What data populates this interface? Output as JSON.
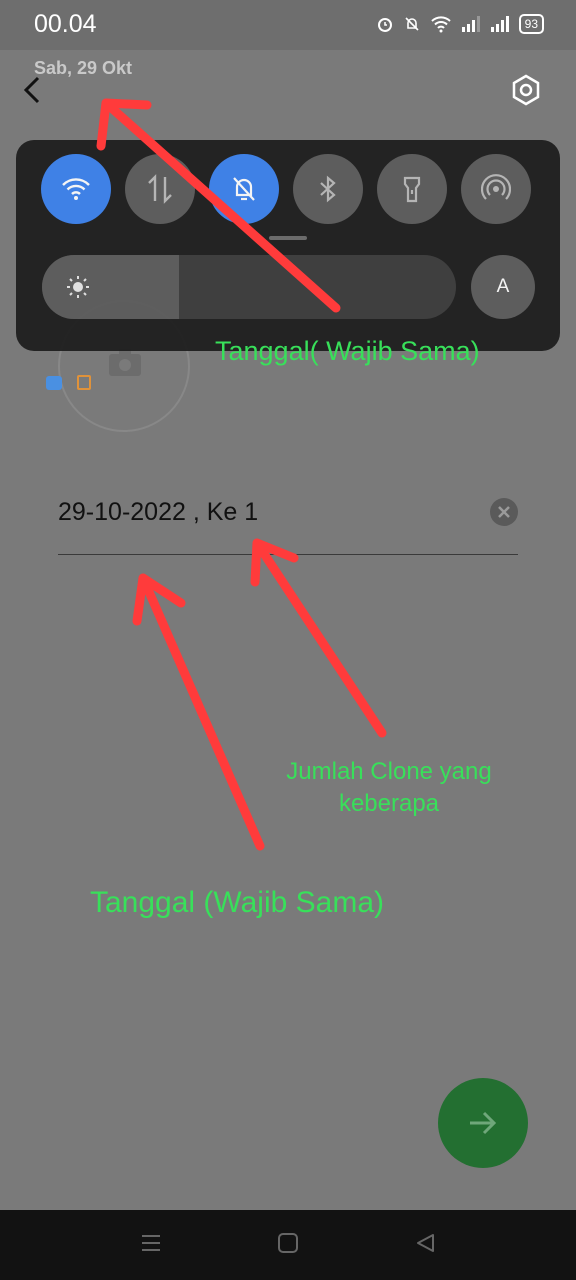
{
  "status_bar": {
    "time": "00.04",
    "battery": "93",
    "icons": [
      "alarm-icon",
      "bell-off-icon",
      "wifi-icon",
      "signal-icon",
      "signal-icon",
      "battery-icon"
    ]
  },
  "header": {
    "date": "Sab, 29 Okt",
    "back_icon": "chevron-left-icon",
    "settings_icon": "hexagon-settings-icon"
  },
  "quick_settings": {
    "tiles": [
      {
        "icon": "wifi-icon",
        "active": true
      },
      {
        "icon": "mobile-data-icon",
        "active": false
      },
      {
        "icon": "bell-off-icon",
        "active": true
      },
      {
        "icon": "bluetooth-icon",
        "active": false
      },
      {
        "icon": "flashlight-icon",
        "active": false
      },
      {
        "icon": "hotspot-icon",
        "active": false
      }
    ],
    "brightness_level": 0.33,
    "auto_label": "A"
  },
  "form": {
    "input_value": "29-10-2022 , Ke 1"
  },
  "annotations": {
    "top": "Tanggal( Wajib Sama)",
    "middle": "Jumlah Clone yang keberapa",
    "bottom": "Tanggal (Wajib Sama)"
  },
  "colors": {
    "accent_blue": "#3b82f0",
    "next_button": "#236f31",
    "annotation_text": "#38e05a",
    "arrow": "#ff3b3b"
  }
}
